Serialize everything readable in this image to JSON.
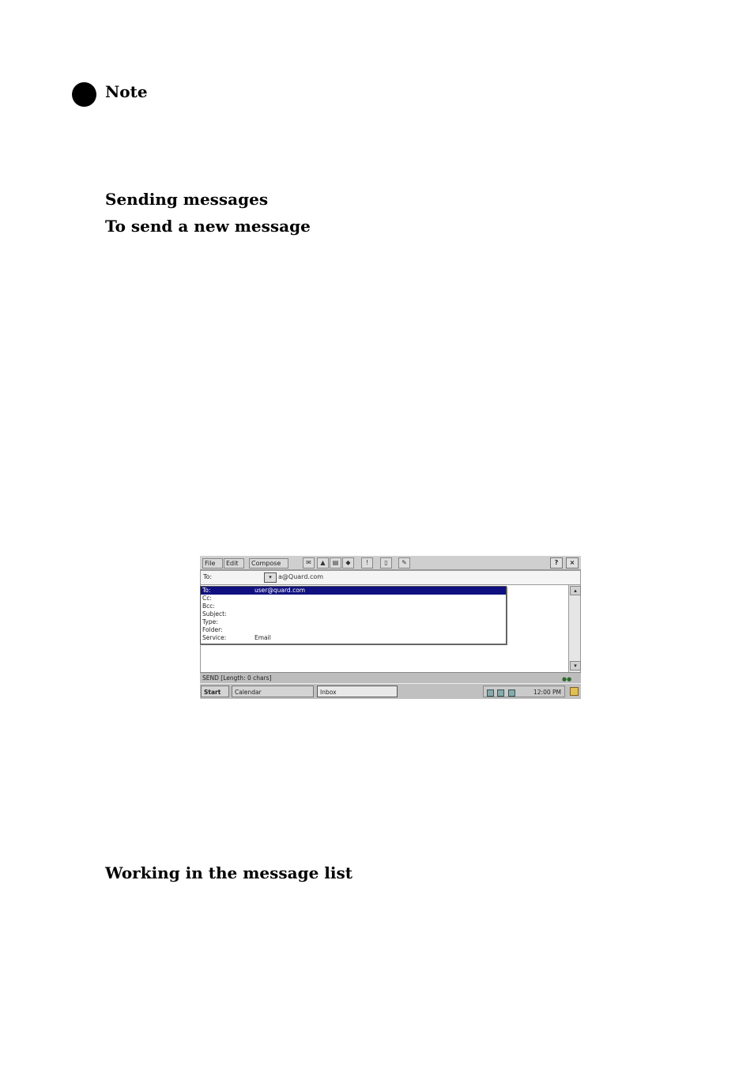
{
  "headings": {
    "note": "Note",
    "sending": "Sending messages",
    "new_message": "To send a new message",
    "message_list": "Working in the message list"
  },
  "screenshot": {
    "menu": {
      "file": "File",
      "edit": "Edit",
      "compose": "Compose"
    },
    "title_buttons": {
      "help": "?",
      "close": "×"
    },
    "to_field": {
      "label": "To:",
      "value": "a@Quard.com",
      "dropdown_arrow": "▾"
    },
    "dropdown_items": [
      {
        "label": "To:",
        "value": "user@quard.com"
      },
      {
        "label": "Cc:",
        "value": ""
      },
      {
        "label": "Bcc:",
        "value": ""
      },
      {
        "label": "Subject:",
        "value": ""
      },
      {
        "label": "Type:",
        "value": ""
      },
      {
        "label": "Folder:",
        "value": ""
      },
      {
        "label": "Service:",
        "value": "Email"
      }
    ],
    "scroll_up": "▴",
    "scroll_down": "▾",
    "status_text": "SEND [Length: 0 chars]",
    "taskbar": {
      "start": "Start",
      "task_a": "Calendar",
      "task_b": "Inbox",
      "clock": "12:00 PM"
    }
  }
}
